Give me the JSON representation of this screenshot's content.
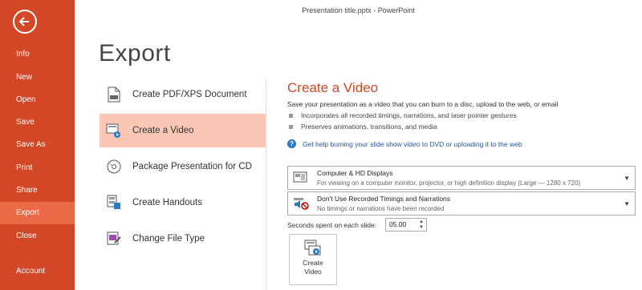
{
  "window": {
    "title": "Presentation title.pptx - PowerPoint"
  },
  "nav": {
    "back_icon": "back-arrow-icon",
    "items": [
      {
        "label": "Info"
      },
      {
        "label": "New"
      },
      {
        "label": "Open"
      },
      {
        "label": "Save"
      },
      {
        "label": "Save As"
      },
      {
        "label": "Print"
      },
      {
        "label": "Share"
      },
      {
        "label": "Export",
        "active": true
      },
      {
        "label": "Close"
      },
      {
        "label": "Account"
      }
    ]
  },
  "page": {
    "title": "Export"
  },
  "options": [
    {
      "label": "Create PDF/XPS Document",
      "icon": "pdf-document-icon"
    },
    {
      "label": "Create a Video",
      "icon": "video-icon",
      "active": true
    },
    {
      "label": "Package Presentation for CD",
      "icon": "cd-icon"
    },
    {
      "label": "Create Handouts",
      "icon": "handouts-icon"
    },
    {
      "label": "Change File Type",
      "icon": "change-file-type-icon"
    }
  ],
  "detail": {
    "title": "Create a Video",
    "description": "Save your presentation as a video that you can burn to a disc, upload to the web, or email",
    "bullets": [
      "Incorporates all recorded timings, narrations, and laser pointer gestures",
      "Preserves animations, transitions, and media"
    ],
    "help_link": "Get help burning your slide show video to DVD or uploading it to the web",
    "quality_dropdown": {
      "main": "Computer & HD Displays",
      "sub": "For viewing on a computer monitor, projector, or high definition display  (Large — 1280 x 720)"
    },
    "timings_dropdown": {
      "main": "Don't Use Recorded Timings and Narrations",
      "sub": "No timings or narrations have been recorded"
    },
    "seconds_label": "Seconds spent on each slide:",
    "seconds_value": "05.00",
    "create_button": {
      "line1": "Create",
      "line2": "Video"
    }
  },
  "colors": {
    "accent": "#d24726",
    "active_nav": "#ea6a47",
    "active_option": "#f9c7b4",
    "link": "#2b5797"
  }
}
